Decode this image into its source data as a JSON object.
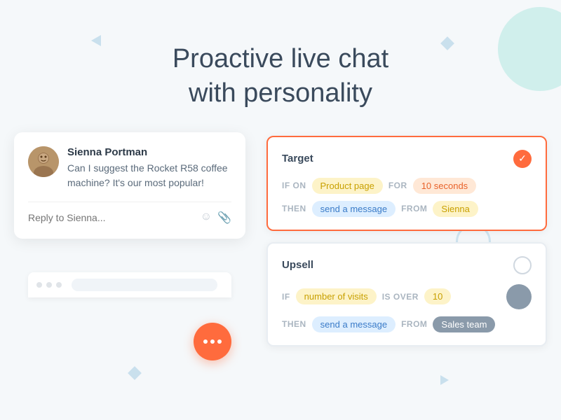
{
  "header": {
    "line1": "Proactive live chat",
    "line2": "with personality"
  },
  "chat": {
    "avatar_label": "👩",
    "sender_name": "Sienna Portman",
    "message": "Can I suggest the Rocket R58 coffee machine? It's our most popular!",
    "reply_placeholder": "Reply to Sienna...",
    "fab_accessible_label": "Open chat"
  },
  "rules": {
    "target": {
      "title": "Target",
      "is_active": true,
      "check_icon": "✓",
      "row1": {
        "if_label": "IF ON",
        "condition_tag": "Product page",
        "for_label": "FOR",
        "value_tag": "10 seconds"
      },
      "row2": {
        "then_label": "THEN",
        "action_tag": "send a message",
        "from_label": "FROM",
        "from_tag": "Sienna"
      }
    },
    "upsell": {
      "title": "Upsell",
      "is_active": false,
      "row1": {
        "if_label": "IF",
        "condition_tag": "number of visits",
        "is_over_label": "IS OVER",
        "value_tag": "10"
      },
      "row2": {
        "then_label": "THEN",
        "action_tag": "send a message",
        "from_label": "FROM",
        "from_tag": "Sales team"
      }
    }
  },
  "decorations": {
    "bg_color": "#f5f8fa"
  }
}
